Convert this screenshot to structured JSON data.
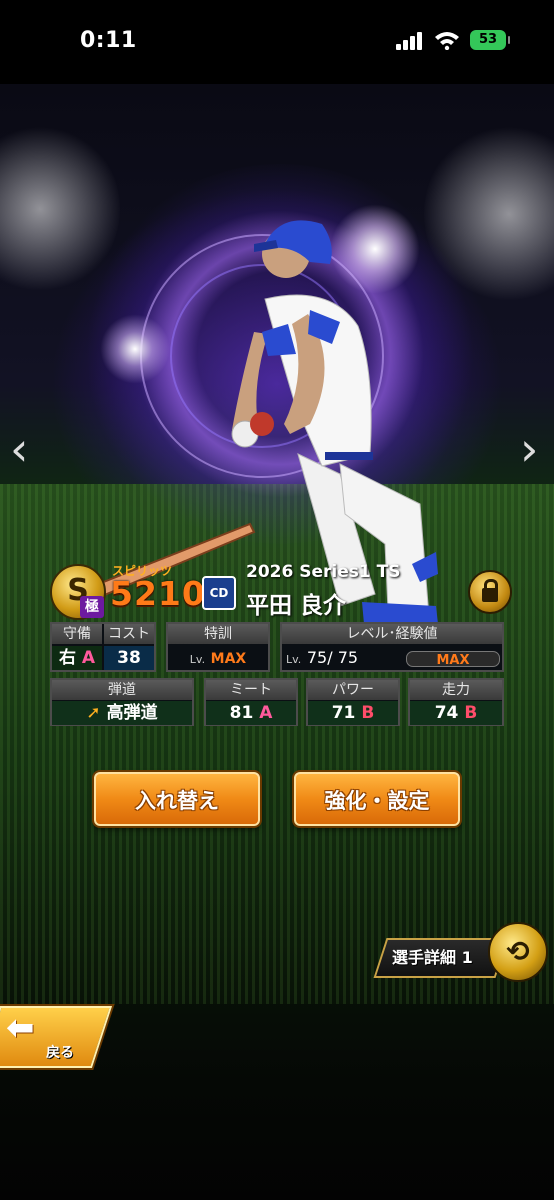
{
  "status_bar": {
    "time": "0:11",
    "battery": "53"
  },
  "card": {
    "rank": "S",
    "rank_sub": "極",
    "spirits_label": "スピリッツ",
    "spirits": "5210",
    "team_logo": "CD",
    "series": "2026 Series1 TS",
    "name": "平田 良介"
  },
  "stats_row1": {
    "defense_header": "守備",
    "defense_pos": "右",
    "defense_grade": "A",
    "cost_header": "コスト",
    "cost": "38",
    "training_header": "特訓",
    "training_lv": "Lv.",
    "training_val": "MAX",
    "level_header": "レベル･経験値",
    "level_lv": "Lv.",
    "level_val": "75/ 75",
    "exp_val": "MAX"
  },
  "stats_row2": {
    "trajectory_header": "弾道",
    "trajectory_val": "高弾道",
    "meet_header": "ミート",
    "meet_val": "81",
    "meet_grade": "A",
    "power_header": "パワー",
    "power_val": "71",
    "power_grade": "B",
    "speed_header": "走力",
    "speed_val": "74",
    "speed_grade": "B"
  },
  "buttons": {
    "swap": "入れ替え",
    "enhance": "強化・設定",
    "detail": "選手詳細 1",
    "back": "戻る"
  },
  "icons": {
    "nav_left": "chevron-left-icon",
    "nav_right": "chevron-right-icon",
    "lock": "lock-icon",
    "swap": "refresh-icon",
    "back": "back-arrow-icon"
  }
}
